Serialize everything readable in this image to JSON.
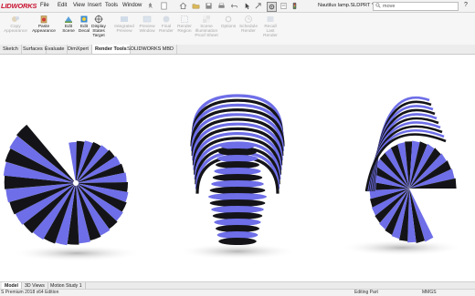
{
  "app": {
    "logo_text": "SOLIDWORKS",
    "logo_visible": "LIDWORKS"
  },
  "menu": [
    {
      "label": "File"
    },
    {
      "label": "Edit"
    },
    {
      "label": "View"
    },
    {
      "label": "Insert"
    },
    {
      "label": "Tools"
    },
    {
      "label": "Window"
    }
  ],
  "document": {
    "filename": "Nautilus lamp.SLDPRT *"
  },
  "search": {
    "value": "move"
  },
  "help": {
    "label": "?"
  },
  "ribbon": [
    {
      "label": "Copy\nAppearance",
      "icon": "copy-appearance-icon",
      "enabled": false
    },
    {
      "label": "Paste\nAppearance",
      "icon": "paste-appearance-icon",
      "enabled": true
    },
    {
      "label": "Edit\nScene",
      "icon": "edit-scene-icon",
      "enabled": true
    },
    {
      "label": "Edit\nDecal",
      "icon": "edit-decal-icon",
      "enabled": true
    },
    {
      "label": "Display\nStates\nTarget",
      "icon": "display-states-icon",
      "enabled": true
    },
    {
      "label": "Integrated\nPreview",
      "icon": "integrated-preview-icon",
      "enabled": false
    },
    {
      "label": "Preview\nWindow",
      "icon": "preview-window-icon",
      "enabled": false
    },
    {
      "label": "Final\nRender",
      "icon": "final-render-icon",
      "enabled": false
    },
    {
      "label": "Render\nRegion",
      "icon": "render-region-icon",
      "enabled": false
    },
    {
      "label": "Scene\nIllumination\nProof Sheet",
      "icon": "illumination-icon",
      "enabled": false
    },
    {
      "label": "Options",
      "icon": "options-icon",
      "enabled": false
    },
    {
      "label": "Schedule\nRender",
      "icon": "schedule-render-icon",
      "enabled": false
    },
    {
      "label": "Recall\nLast\nRender",
      "icon": "recall-render-icon",
      "enabled": false
    }
  ],
  "tabs": [
    {
      "label": "Sketch"
    },
    {
      "label": "Surfaces"
    },
    {
      "label": "Evaluate"
    },
    {
      "label": "DimXpert"
    },
    {
      "label": "Render Tools",
      "active": true
    },
    {
      "label": "SOLIDWORKS MBD"
    }
  ],
  "bottom_tabs": [
    {
      "label": "Model",
      "active": true
    },
    {
      "label": "3D Views"
    },
    {
      "label": "Motion Study 1"
    }
  ],
  "status": {
    "left": "S Premium 2018 x64 Edition",
    "mode": "Editing Part",
    "units": "MMGS"
  },
  "colors": {
    "rib_blue": "#6e6ee8",
    "rib_dark": "#141418",
    "logo_red": "#c8102e"
  }
}
